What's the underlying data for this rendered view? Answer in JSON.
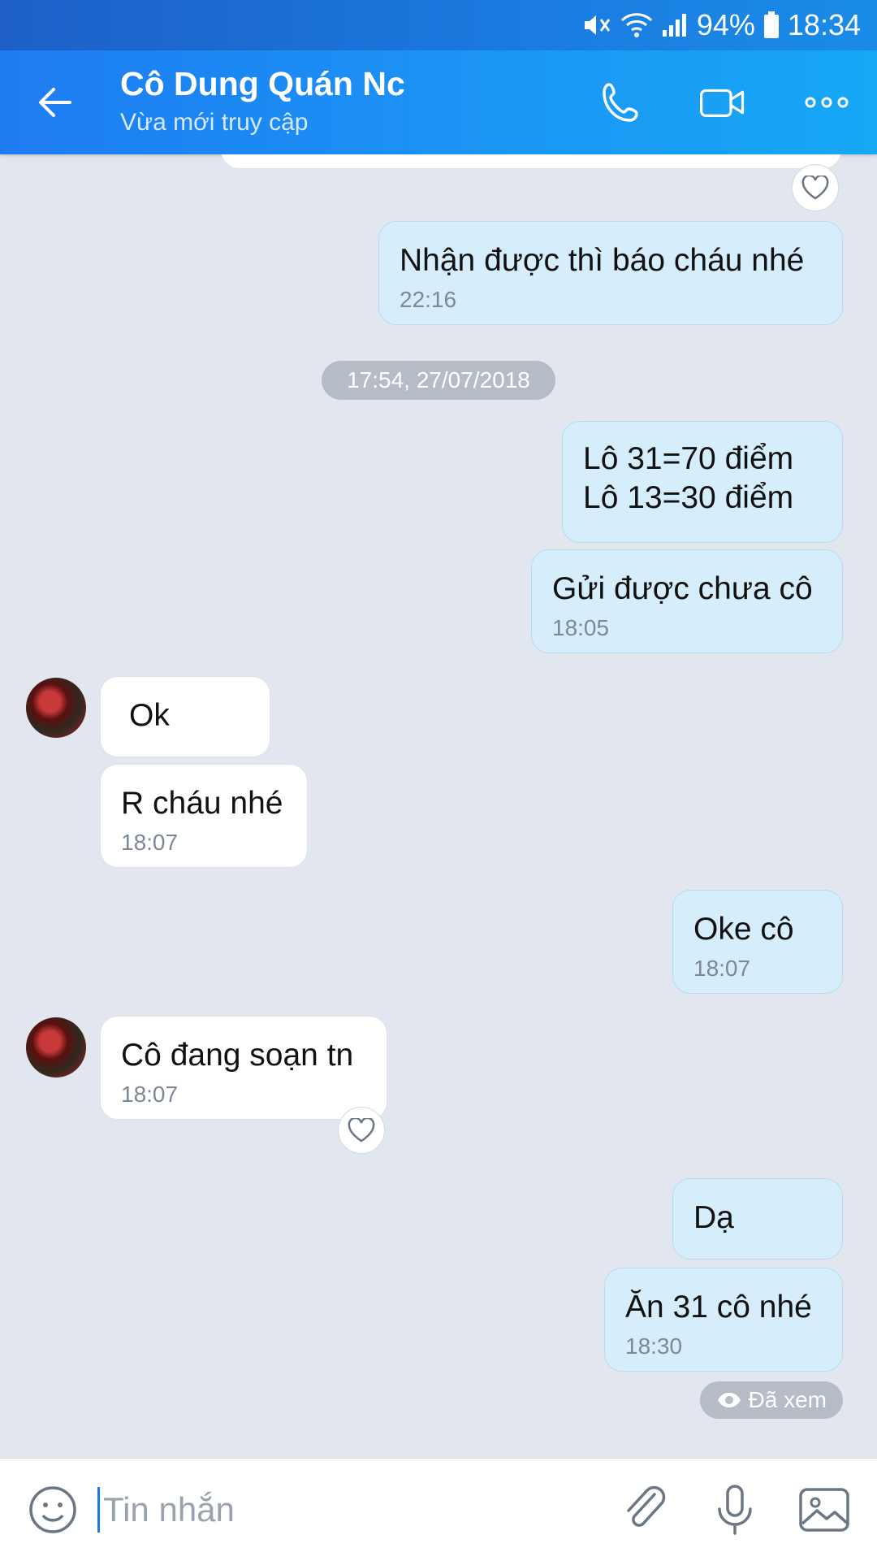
{
  "status_bar": {
    "battery": "94%",
    "time": "18:34"
  },
  "header": {
    "title": "Cô Dung Quán Nc",
    "subtitle": "Vừa mới truy cập"
  },
  "messages": [
    {
      "text": "Nhận được thì báo cháu nhé",
      "time": "22:16"
    },
    {
      "text": "Lô 31=70 điểm",
      "text2": "Lô 13=30 điểm"
    },
    {
      "text": "Gửi được chưa cô",
      "time": "18:05"
    },
    {
      "text": "Ok"
    },
    {
      "text": "R cháu nhé",
      "time": "18:07"
    },
    {
      "text": "Oke cô",
      "time": "18:07"
    },
    {
      "text": "Cô đang soạn tn",
      "time": "18:07"
    },
    {
      "text": "Dạ"
    },
    {
      "text": "Ăn 31 cô nhé",
      "time": "18:30"
    }
  ],
  "date_separator": "17:54, 27/07/2018",
  "seen_label": "Đã xem",
  "input": {
    "placeholder": "Tin nhắn"
  },
  "icons": {
    "back": "arrow-left-icon",
    "call": "phone-icon",
    "video": "video-camera-icon",
    "more": "more-dots-icon",
    "emoji": "emoji-icon",
    "attach": "paperclip-icon",
    "mic": "microphone-icon",
    "image": "image-icon",
    "heart": "heart-icon",
    "eye": "eye-icon"
  },
  "colors": {
    "accent": "#1a8be8",
    "my_bubble": "#d6eefc",
    "their_bubble": "#ffffff",
    "background": "#e2e7ef"
  }
}
